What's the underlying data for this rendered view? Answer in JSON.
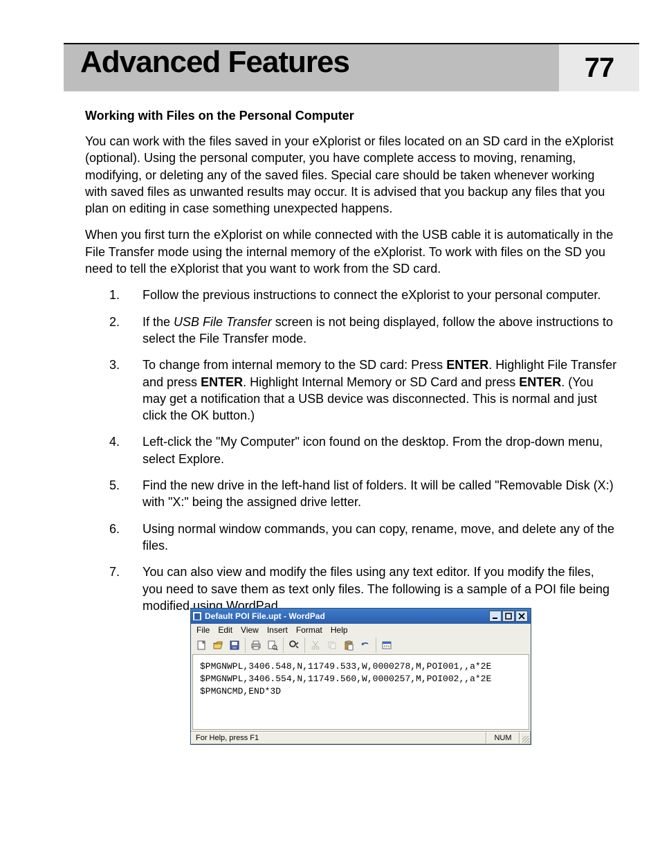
{
  "header": {
    "title": "Advanced Features",
    "page_number": "77"
  },
  "section": {
    "heading": "Working with Files on the Personal Computer",
    "para1": "You can work with the files saved in your eXplorist or files located on an SD card in the eXplorist (optional).  Using the personal computer, you have complete access to moving, renaming, modifying, or deleting any of the saved files.  Special care should be taken whenever working with saved files as unwanted results may occur.  It is advised that you backup any files that you plan on editing in case something unexpected happens.",
    "para2": "When you first turn the eXplorist on while connected with the USB cable it is automatically in the File Transfer mode using the internal memory of the eXplorist.  To work with files on the SD you need to tell the eXplorist that you want to work from the SD card.",
    "steps": {
      "s1": "Follow the previous instructions to connect the eXplorist to your personal computer.",
      "s2_pre": "If the ",
      "s2_usb": "USB File Transfer",
      "s2_mid": " screen is not being displayed, follow the above instructions to select the ",
      "s2_ft": "File Transfer",
      "s2_post": " mode.",
      "s3_a": "To change from internal memory to the SD card: Press ",
      "s3_enter1": "ENTER",
      "s3_b": ".  Highlight ",
      "s3_ft": "File Transfer",
      "s3_c": " and press ",
      "s3_enter2": "ENTER",
      "s3_d": ".  Highlight ",
      "s3_im": "Internal Memory",
      "s3_e": " or ",
      "s3_sd": "SD Card",
      "s3_f": " and press ",
      "s3_enter3": "ENTER",
      "s3_g": ".  (You may get a notification that a USB device was disconnected.  This is normal and just click the OK button.)",
      "s4": "Left-click the \"My Computer\" icon found on the desktop.  From the drop-down menu, select Explore.",
      "s5": "Find the new drive in the left-hand list of folders.  It will be called \"Removable Disk (X:) with \"X:\" being the assigned drive letter.",
      "s6": "Using normal window commands, you can copy, rename, move, and delete any of the files.",
      "s7": "You can also view and modify the files using any text editor.  If you modify the files, you need to save them as text only files.  The following is a sample of a POI file being modified using WordPad."
    }
  },
  "wordpad": {
    "title": "Default POI File.upt - WordPad",
    "menus": [
      "File",
      "Edit",
      "View",
      "Insert",
      "Format",
      "Help"
    ],
    "toolbar_icons": [
      "new",
      "open",
      "save",
      "print",
      "print-preview",
      "find",
      "cut",
      "copy",
      "paste",
      "undo",
      "date-time"
    ],
    "content_lines": [
      "$PMGNWPL,3406.548,N,11749.533,W,0000278,M,POI001,,a*2E",
      "$PMGNWPL,3406.554,N,11749.560,W,0000257,M,POI002,,a*2E",
      "$PMGNCMD,END*3D"
    ],
    "status_help": "For Help, press F1",
    "status_num": "NUM"
  }
}
